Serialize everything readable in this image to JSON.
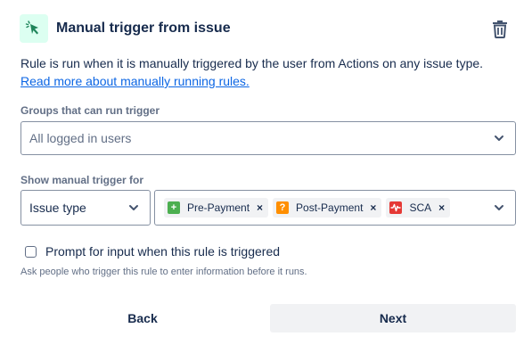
{
  "header": {
    "title": "Manual trigger from issue",
    "trigger_icon": "cursor-click-icon",
    "delete_icon": "trash-icon"
  },
  "description": "Rule is run when it is manually triggered by the user from Actions on any issue type.",
  "read_more_link": "Read more about manually running rules.",
  "groups": {
    "label": "Groups that can run trigger",
    "value": "All logged in users"
  },
  "show_trigger": {
    "label": "Show manual trigger for",
    "type_value": "Issue type",
    "issue_types": [
      {
        "label": "Pre-Payment",
        "icon": "plus-icon",
        "color": "#4caf50",
        "remove": "×"
      },
      {
        "label": "Post-Payment",
        "icon": "question-icon",
        "color": "#ff8f00",
        "remove": "×"
      },
      {
        "label": "SCA",
        "icon": "pulse-icon",
        "color": "#e53935",
        "remove": "×"
      }
    ]
  },
  "prompt": {
    "label": "Prompt for input when this rule is triggered",
    "checked": false,
    "helper": "Ask people who trigger this rule to enter information before it runs."
  },
  "buttons": {
    "back": "Back",
    "next": "Next"
  },
  "colors": {
    "link": "#0c66e4",
    "trigger_icon_bg": "#dcfff1",
    "trigger_icon_fg": "#1f845a"
  }
}
